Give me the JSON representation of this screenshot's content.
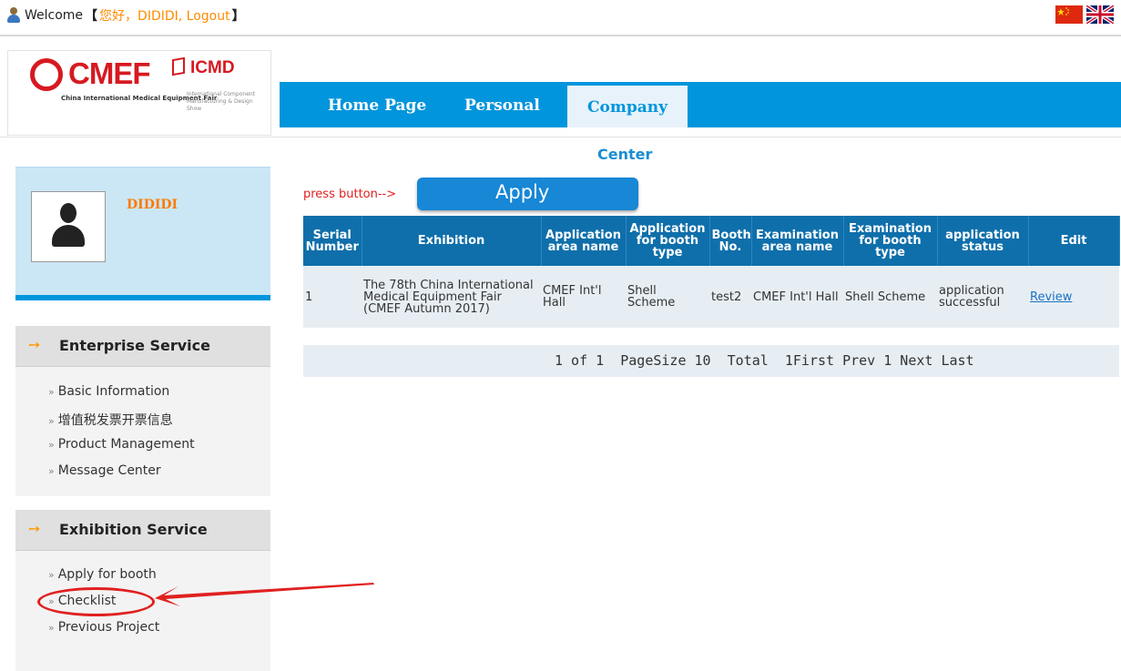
{
  "topbar": {
    "welcome_prefix": "Welcome",
    "bracket_open": "【",
    "greeting": "您好，DIDIDI, Logout",
    "bracket_close": "】",
    "flags": [
      "cn-flag-icon",
      "uk-flag-icon"
    ]
  },
  "logo": {
    "cmef": "CMEF",
    "cmef_sub": "China International Medical Equipment Fair",
    "icmd": "ICMD",
    "icmd_sub": "International Component Manufacturing & Design Show"
  },
  "nav": {
    "tabs": [
      {
        "label": "Home Page"
      },
      {
        "label": "Personal"
      },
      {
        "label": "Company"
      }
    ],
    "active": "Company",
    "color": "#0095dc"
  },
  "sidebar": {
    "username": "DIDIDI",
    "sections": [
      {
        "title": "Enterprise Service",
        "items": [
          "Basic Information",
          "增值税发票开票信息",
          "Product Management",
          "Message Center"
        ]
      },
      {
        "title": "Exhibition Service",
        "items": [
          "Apply for booth",
          "Checklist",
          "Previous Project"
        ]
      }
    ]
  },
  "main": {
    "title": "Center",
    "press_hint": "press button-->",
    "apply_label": "Apply",
    "columns": [
      "Serial Number",
      "Exhibition",
      "Application area name",
      "Application for booth type",
      "Booth No.",
      "Examination area name",
      "Examination for booth type",
      "application status",
      "Edit"
    ],
    "rows": [
      {
        "serial": "1",
        "exhibition": "The 78th China International Medical Equipment Fair (CMEF Autumn 2017)",
        "app_area": "CMEF Int'l Hall",
        "app_booth_type": "Shell Scheme",
        "booth_no": "test2",
        "exam_area": "CMEF Int'l Hall",
        "exam_booth_type": "Shell Scheme",
        "status": "application successful",
        "edit": "Review"
      }
    ],
    "pager": "1 of 1  PageSize 10  Total  1First Prev 1 Next Last"
  },
  "annotation": {
    "highlight_color": "#e02020"
  }
}
